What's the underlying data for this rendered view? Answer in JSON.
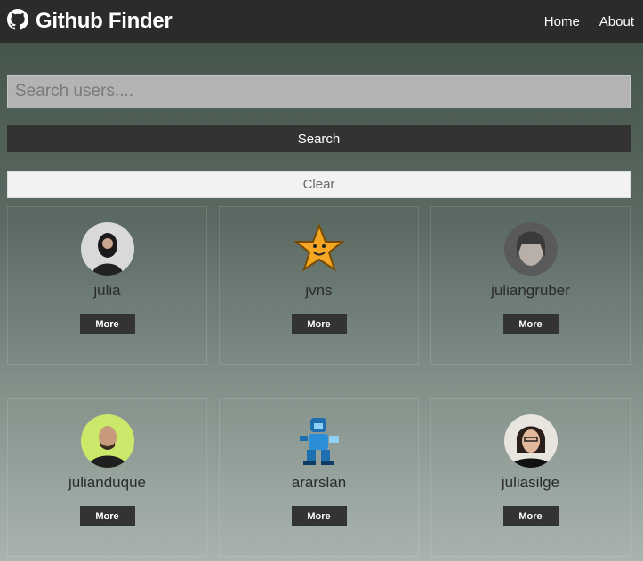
{
  "navbar": {
    "brand_icon": "github-icon",
    "title": "Github Finder",
    "links": [
      "Home",
      "About"
    ]
  },
  "search": {
    "placeholder": "Search users....",
    "value": "",
    "search_label": "Search",
    "clear_label": "Clear"
  },
  "users": [
    {
      "login": "julia",
      "more_label": "More",
      "avatar_icon": "avatar-photo"
    },
    {
      "login": "jvns",
      "more_label": "More",
      "avatar_icon": "star-avatar"
    },
    {
      "login": "juliangruber",
      "more_label": "More",
      "avatar_icon": "avatar-photo"
    },
    {
      "login": "julianduque",
      "more_label": "More",
      "avatar_icon": "avatar-photo"
    },
    {
      "login": "ararslan",
      "more_label": "More",
      "avatar_icon": "robot-avatar"
    },
    {
      "login": "juliasilge",
      "more_label": "More",
      "avatar_icon": "avatar-photo"
    }
  ],
  "colors": {
    "navbar_bg": "#2a2b2a",
    "button_dark": "#333333",
    "clear_bg": "#f2f2f2"
  }
}
